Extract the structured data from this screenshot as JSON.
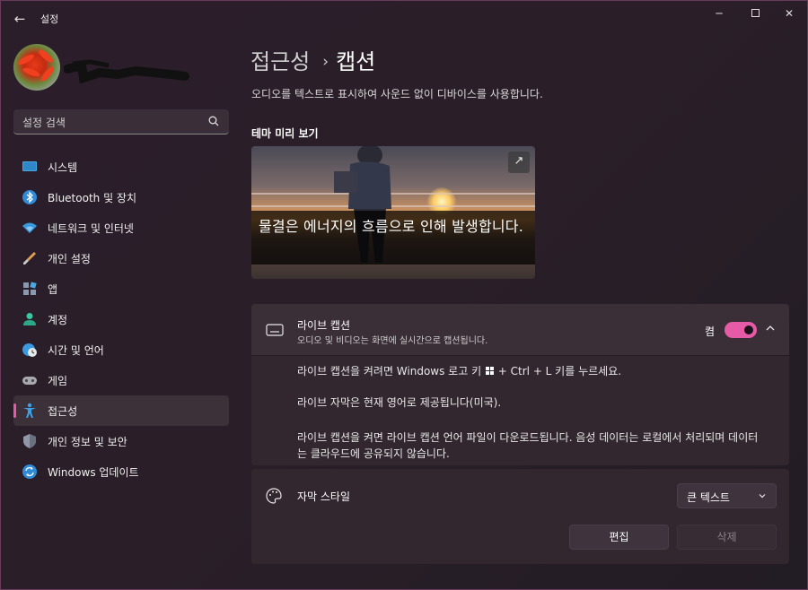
{
  "titlebar": {
    "back_icon": "arrow-left-icon",
    "app_title": "설정",
    "minimize": "─",
    "close": "✕"
  },
  "search": {
    "placeholder": "설정 검색"
  },
  "sidebar": {
    "items": [
      {
        "label": "시스템",
        "icon": "monitor-icon"
      },
      {
        "label": "Bluetooth 및 장치",
        "icon": "bluetooth-icon"
      },
      {
        "label": "네트워크 및 인터넷",
        "icon": "wifi-icon"
      },
      {
        "label": "개인 설정",
        "icon": "brush-icon"
      },
      {
        "label": "앱",
        "icon": "apps-icon"
      },
      {
        "label": "계정",
        "icon": "person-icon"
      },
      {
        "label": "시간 및 언어",
        "icon": "globe-clock-icon"
      },
      {
        "label": "게임",
        "icon": "gamepad-icon"
      },
      {
        "label": "접근성",
        "icon": "accessibility-icon",
        "active": true
      },
      {
        "label": "개인 정보 및 보안",
        "icon": "shield-icon"
      },
      {
        "label": "Windows 업데이트",
        "icon": "update-icon"
      }
    ]
  },
  "main": {
    "breadcrumb_parent": "접근성",
    "breadcrumb_sep": "›",
    "breadcrumb_current": "캡션",
    "description": "오디오를 텍스트로 표시하여 사운드 없이 디바이스를 사용합니다.",
    "preview_title": "테마 미리 보기",
    "preview_caption": "물결은 에너지의 흐름으로 인해 발생합니다.",
    "expand_icon": "↗"
  },
  "live_caption": {
    "title": "라이브 캡션",
    "subtitle": "오디오 및 비디오는 화면에 실시간으로 캡션됩니다.",
    "toggle_label": "켬",
    "toggle_on": true,
    "line1_prefix": "라이브 캡션을 켜려면 Windows 로고 키",
    "line1_suffix": "+ Ctrl + L 키를 누르세요.",
    "line2": "라이브 자막은 현재 영어로 제공됩니다(미국).",
    "line3": "라이브 캡션을 켜면 라이브 캡션 언어 파일이 다운로드됩니다. 음성 데이터는 로컬에서 처리되며 데이터는 클라우드에 공유되지 않습니다."
  },
  "caption_style": {
    "title": "자막 스타일",
    "selected": "큰 텍스트",
    "edit_label": "편집",
    "delete_label": "삭제"
  },
  "colors": {
    "accent": "#e75aa8",
    "window_bg": "#2a1f2a",
    "card_bg": "#32272f"
  }
}
